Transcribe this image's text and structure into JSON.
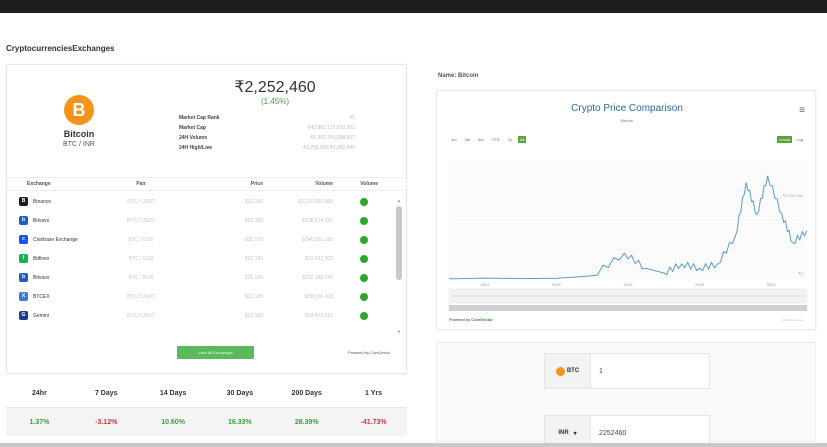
{
  "page": {
    "heading": "CryptocurrenciesExchanges"
  },
  "coin": {
    "symbol_glyph": "B",
    "name": "Bitcoin",
    "pair": "BTC / INR",
    "price": "₹2,252,460",
    "change": "(1.45%)",
    "stats": [
      {
        "label": "Market Cap Rank",
        "value": "#1"
      },
      {
        "label": "Market Cap",
        "value": "₹43,962,171,613,202"
      },
      {
        "label": "24H Volume",
        "value": "₹1,303,741,358,557"
      },
      {
        "label": "24H High/Low",
        "value": "₹2,259,920/₹2,182,945"
      }
    ]
  },
  "exchanges": {
    "columns": [
      "Exchange",
      "Pair",
      "Price",
      "Volume",
      "Volume"
    ],
    "rows": [
      {
        "name": "Binance",
        "icon_color": "#1e1e1e",
        "glyph": "B",
        "pair": "BTC / USDT",
        "price": "$21,196",
        "volume": "$2,229,991,980"
      },
      {
        "name": "Bitvavo",
        "icon_color": "#1f5fbf",
        "glyph": "b",
        "pair": "BTC / USDT",
        "price": "$21,180",
        "volume": "$138,514,321"
      },
      {
        "name": "Coinbase Exchange",
        "icon_color": "#1652f0",
        "glyph": "c",
        "pair": "BTC / USD",
        "price": "$21,178",
        "volume": "$346,291,165"
      },
      {
        "name": "Bitfinex",
        "icon_color": "#16b157",
        "glyph": "f",
        "pair": "BTC / USD",
        "price": "$21,193",
        "volume": "$72,567,303"
      },
      {
        "name": "Bitvavo",
        "icon_color": "#1f5fbf",
        "glyph": "b",
        "pair": "BTC / EUR",
        "price": "$21,166",
        "volume": "$212,188,341"
      },
      {
        "name": "BTCEX",
        "icon_color": "#3a7bd5",
        "glyph": "X",
        "pair": "BTC / USDT",
        "price": "$21,188",
        "volume": "$58,090,108"
      },
      {
        "name": "Gemini",
        "icon_color": "#1b3f8f",
        "glyph": "G",
        "pair": "BTC / USDT",
        "price": "$21,182",
        "volume": "$34,401,512"
      }
    ],
    "view_all_label": "View All Exchanges",
    "powered_by": "Powered by CoinGecko"
  },
  "periods": {
    "labels": [
      "24hr",
      "7 Days",
      "14 Days",
      "30 Days",
      "200 Days",
      "1 Yrs"
    ],
    "values": [
      "1.37%",
      "-3.12%",
      "10.60%",
      "16.33%",
      "28.39%",
      "-41.73%"
    ],
    "positive_color": "#3ca13c",
    "negative_color": "#d9363e"
  },
  "right": {
    "name_label": "Name: Bitcoin",
    "chart_title": "Crypto Price Comparison",
    "chart_subtitle": "Bitcoin",
    "menu_icon": "menu-icon",
    "ranges": [
      "1m",
      "3m",
      "6m",
      "YTD",
      "1y",
      "All"
    ],
    "active_range": "All",
    "scales": [
      "Linear",
      "Log"
    ],
    "active_scale": "Linear",
    "x_ticks": [
      "2014",
      "2016",
      "2018",
      "2020",
      "2022"
    ],
    "y_ticks": [
      "₹5,000,000",
      "₹0"
    ],
    "powered_by_prefix": "Powered by",
    "powered_by_name": "CoinGecko",
    "credit": "Highcharts.com",
    "line_color": "#5b9bd5"
  },
  "converter": {
    "btc_label": "BTC",
    "btc_value": "1",
    "fiat_label": "INR",
    "fiat_value": "2252460"
  },
  "chart_data": {
    "type": "line",
    "title": "Crypto Price Comparison",
    "subtitle": "Bitcoin",
    "x": [
      "2013",
      "2014",
      "2015",
      "2016",
      "2017",
      "2017.9",
      "2018.5",
      "2019",
      "2019.5",
      "2020",
      "2020.5",
      "2021",
      "2021.3",
      "2021.6",
      "2021.9",
      "2022.3",
      "2022.6",
      "2023"
    ],
    "values": [
      0.01,
      0.04,
      0.02,
      0.03,
      0.15,
      1.2,
      0.5,
      0.28,
      0.7,
      0.5,
      0.7,
      2.0,
      4.5,
      3.0,
      4.8,
      3.0,
      1.7,
      2.25
    ],
    "xlabel": "",
    "ylabel": "",
    "ylim": [
      0,
      5.5
    ],
    "y_unit": "₹M"
  }
}
